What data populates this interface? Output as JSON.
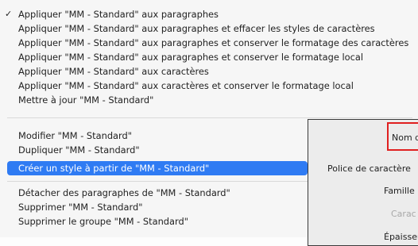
{
  "context_menu": {
    "group1": [
      {
        "label": "Appliquer \"MM - Standard\" aux paragraphes",
        "checked": true
      },
      {
        "label": "Appliquer \"MM - Standard\" aux paragraphes et effacer les styles de caractères"
      },
      {
        "label": "Appliquer \"MM - Standard\" aux paragraphes et conserver le formatage des caractères"
      },
      {
        "label": "Appliquer \"MM - Standard\" aux paragraphes et conserver le formatage local"
      },
      {
        "label": "Appliquer \"MM - Standard\" aux caractères"
      },
      {
        "label": "Appliquer \"MM - Standard\" aux caractères et conserver le formatage local"
      },
      {
        "label": "Mettre à jour \"MM - Standard\""
      }
    ],
    "group2": [
      {
        "label": "Modifier \"MM - Standard\""
      },
      {
        "label": "Dupliquer \"MM - Standard\""
      },
      {
        "label": "Créer un style à partir de \"MM - Standard\""
      }
    ],
    "group3": [
      {
        "label": "Détacher des paragraphes de \"MM - Standard\""
      },
      {
        "label": "Supprimer \"MM - Standard\""
      },
      {
        "label": "Supprimer le groupe \"MM - Standard\""
      }
    ],
    "check_glyph": "✓",
    "highlight_color": "#2f7bf3"
  },
  "dialog": {
    "name_label": "Nom de",
    "section_font": "Police de caractère",
    "family_label": "Famille",
    "style_label": "Carac",
    "weight_label": "Épaisseu"
  }
}
